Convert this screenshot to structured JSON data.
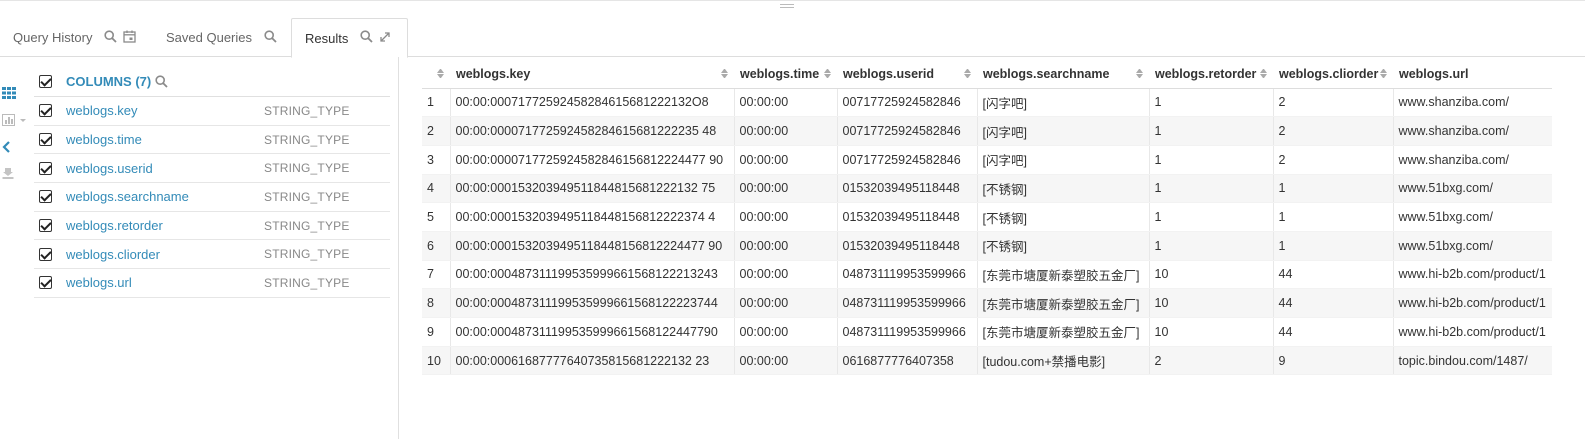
{
  "tabs": {
    "history": "Query History",
    "saved": "Saved Queries",
    "results": "Results"
  },
  "colors": {
    "accent": "#338bb8",
    "row_stripe": "#f6f6f6"
  },
  "columns_panel": {
    "title": "COLUMNS (7)",
    "items": [
      {
        "name": "weblogs.key",
        "type": "STRING_TYPE"
      },
      {
        "name": "weblogs.time",
        "type": "STRING_TYPE"
      },
      {
        "name": "weblogs.userid",
        "type": "STRING_TYPE"
      },
      {
        "name": "weblogs.searchname",
        "type": "STRING_TYPE"
      },
      {
        "name": "weblogs.retorder",
        "type": "STRING_TYPE"
      },
      {
        "name": "weblogs.cliorder",
        "type": "STRING_TYPE"
      },
      {
        "name": "weblogs.url",
        "type": "STRING_TYPE"
      }
    ]
  },
  "table": {
    "headers": [
      "weblogs.key",
      "weblogs.time",
      "weblogs.userid",
      "weblogs.searchname",
      "weblogs.retorder",
      "weblogs.cliorder",
      "weblogs.url"
    ],
    "rows": [
      [
        "1",
        "00:00:00071772592458284615681222132O8",
        "00:00:00",
        "00717725924582846",
        "[闪字吧]",
        "1",
        "2",
        "www.shanziba.com/"
      ],
      [
        "2",
        "00:00:000071772592458284615681222235 48",
        "00:00:00",
        "00717725924582846",
        "[闪字吧]",
        "1",
        "2",
        "www.shanziba.com/"
      ],
      [
        "3",
        "00:00:0000717725924582846156812224477 90",
        "00:00:00",
        "00717725924582846",
        "[闪字吧]",
        "1",
        "2",
        "www.shanziba.com/"
      ],
      [
        "4",
        "00:00:000153203949511844815681222132 75",
        "00:00:00",
        "01532039495118448",
        "[不锈钢]",
        "1",
        "1",
        "www.51bxg.com/"
      ],
      [
        "5",
        "00:00:0001532039495118448156812222374 4",
        "00:00:00",
        "01532039495118448",
        "[不锈钢]",
        "1",
        "1",
        "www.51bxg.com/"
      ],
      [
        "6",
        "00:00:0001532039495118448156812224477 90",
        "00:00:00",
        "01532039495118448",
        "[不锈钢]",
        "1",
        "1",
        "www.51bxg.com/"
      ],
      [
        "7",
        "00:00:000487311199535999661568122213243",
        "00:00:00",
        "048731119953599966",
        "[东莞市塘厦新泰塑胶五金厂]",
        "10",
        "44",
        "www.hi-b2b.com/product/1"
      ],
      [
        "8",
        "00:00:000487311199535999661568122223744",
        "00:00:00",
        "048731119953599966",
        "[东莞市塘厦新泰塑胶五金厂]",
        "10",
        "44",
        "www.hi-b2b.com/product/1"
      ],
      [
        "9",
        "00:00:000487311199535999661568122447790",
        "00:00:00",
        "048731119953599966",
        "[东莞市塘厦新泰塑胶五金厂]",
        "10",
        "44",
        "www.hi-b2b.com/product/1"
      ],
      [
        "10",
        "00:00:00061687777640735815681222132 23",
        "00:00:00",
        "0616877776407358",
        "[tudou.com+禁播电影]",
        "2",
        "9",
        "topic.bindou.com/1487/"
      ]
    ]
  }
}
